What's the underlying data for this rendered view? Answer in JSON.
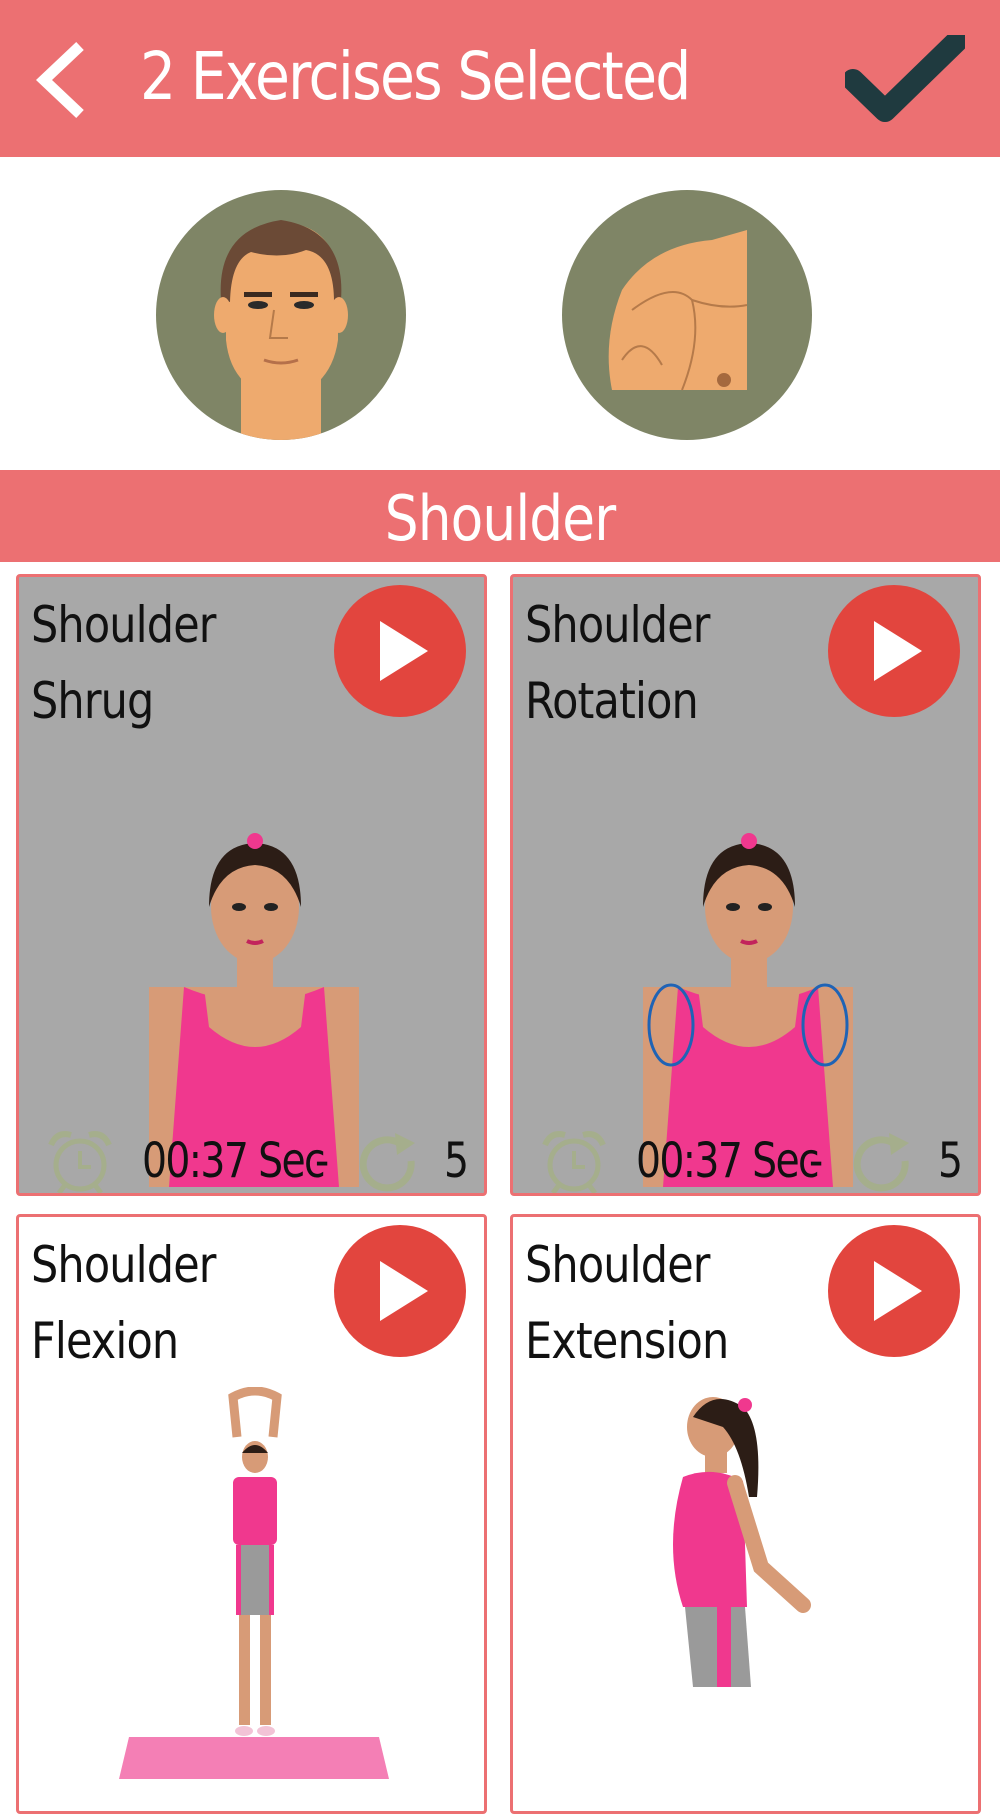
{
  "header": {
    "title": "2 Exercises Selected"
  },
  "avatars": [
    {
      "icon": "face-avatar-icon"
    },
    {
      "icon": "shoulder-avatar-icon"
    }
  ],
  "section": {
    "title": "Shoulder"
  },
  "exercises": [
    {
      "line1": "Shoulder",
      "line2": "Shrug",
      "duration": "00:37 Sec",
      "separator": "-",
      "reps": "5",
      "selected": true
    },
    {
      "line1": "Shoulder",
      "line2": "Rotation",
      "duration": "00:37 Sec",
      "separator": "-",
      "reps": "5",
      "selected": true
    },
    {
      "line1": "Shoulder",
      "line2": "Flexion",
      "selected": false
    },
    {
      "line1": "Shoulder",
      "line2": "Extension",
      "selected": false
    }
  ],
  "colors": {
    "accent": "#ec7072",
    "play": "#e2453e",
    "avatar_bg": "#7f8566",
    "selected_card": "#a8a8a8",
    "check": "#1f3a3f"
  }
}
